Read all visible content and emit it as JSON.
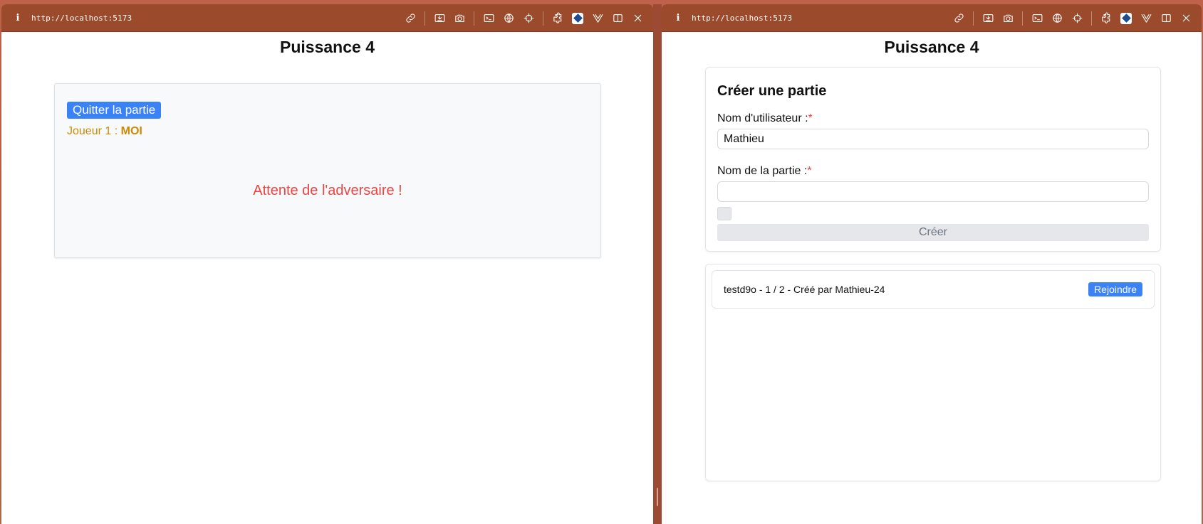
{
  "browser": {
    "url": "http://localhost:5173",
    "info_glyph": "i"
  },
  "app": {
    "title": "Puissance 4"
  },
  "left_window": {
    "quit_button": "Quitter la partie",
    "player_label": "Joueur 1 :",
    "player_name": "MOI",
    "waiting_text": "Attente de l'adversaire !"
  },
  "right_window": {
    "create": {
      "heading": "Créer une partie",
      "username_label": "Nom d'utilisateur :",
      "username_value": "Mathieu",
      "game_name_label": "Nom de la partie :",
      "game_name_value": "",
      "required_mark": "*",
      "submit_label": "Créer"
    },
    "games": [
      {
        "description": "testd9o - 1 / 2 - Créé par Mathieu-24",
        "join_label": "Rejoindre"
      }
    ]
  },
  "icons": [
    "link-icon",
    "download-icon",
    "camera-icon",
    "terminal-icon",
    "globe-icon",
    "crosshair-icon",
    "extension-icon",
    "app-badge-icon",
    "vue-icon",
    "split-view-icon",
    "close-icon"
  ],
  "colors": {
    "toolbar": "#9c4a2c",
    "primary": "#3b82f6",
    "player": "#ca8a04",
    "waiting": "#ef4444",
    "required": "#ef4444"
  }
}
